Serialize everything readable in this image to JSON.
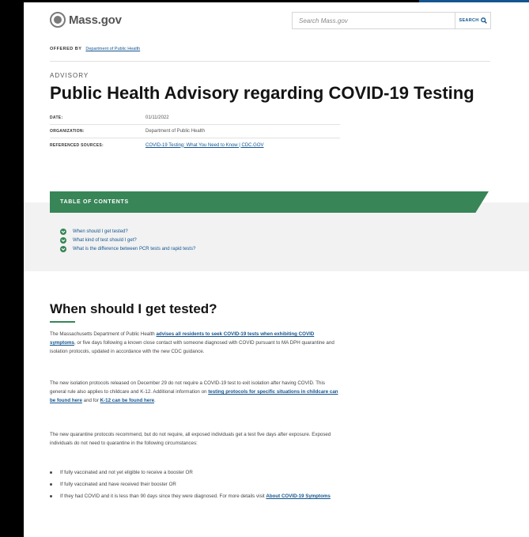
{
  "header": {
    "logo_text": "Mass.gov",
    "search_placeholder": "Search Mass.gov",
    "search_button": "SEARCH"
  },
  "offered_by": {
    "label": "OFFERED BY",
    "link": "Department of Public Health"
  },
  "page": {
    "type_label": "ADVISORY",
    "title": "Public Health Advisory regarding COVID-19 Testing"
  },
  "meta": [
    {
      "key": "DATE:",
      "value": "01/11/2022"
    },
    {
      "key": "ORGANIZATION:",
      "value": "Department of Public Health"
    },
    {
      "key": "REFERENCED SOURCES:",
      "value": "COVID-19 Testing: What You Need to Know | CDC.GOV"
    }
  ],
  "toc": {
    "heading": "TABLE OF CONTENTS",
    "items": [
      "When should I get tested?",
      "What kind of test should I get?",
      "What is the difference between PCR tests and rapid tests?"
    ]
  },
  "section": {
    "heading": "When should I get tested?",
    "p1_a": "The Massachusetts Department of Public Health ",
    "p1_link": "advises all residents to seek COVID-19 tests when exhibiting COVID symptoms",
    "p1_b": ", or five days following a known close contact with someone diagnosed with COVID pursuant to MA DPH quarantine and isolation protocols, updated in accordance with the new CDC guidance.",
    "p2_a": "The new isolation protocols released on December 29 do not require a COVID-19 test to exit isolation after having COVID. This general rule also applies to childcare and K-12.  Additional information on ",
    "p2_link1": "testing protocols for specific situations in childcare can be found here",
    "p2_b": " and for ",
    "p2_link2": "K-12 can be found here",
    "p2_c": ".",
    "p3": "The new quarantine protocols recommend, but do not require, all exposed individuals get a test five days after exposure. Exposed individuals do not need to quarantine in the following circumstances:",
    "bullet1": "If fully vaccinated and not yet eligible to receive a booster OR",
    "bullet2": "If fully vaccinated and have received their booster OR",
    "bullet3_a": "If they had COVID and it is less than 90 days since they were diagnosed.  For more details visit ",
    "bullet3_link": "About COVID-19 Symptoms"
  }
}
